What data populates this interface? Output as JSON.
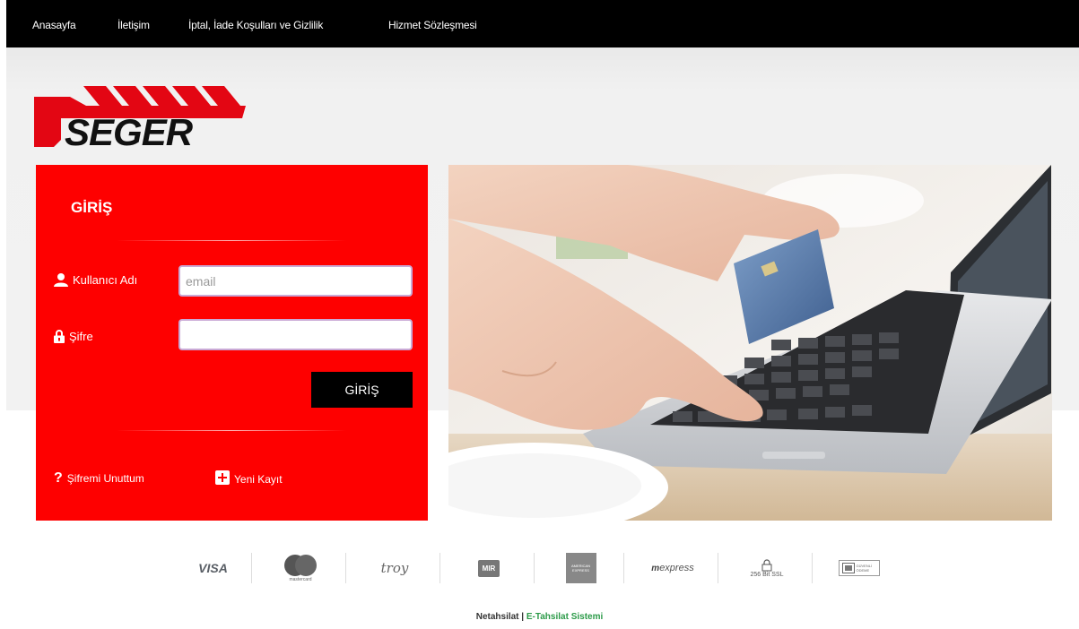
{
  "nav": {
    "items": [
      {
        "label": "Anasayfa"
      },
      {
        "label": "İletişim"
      },
      {
        "label": "İptal, İade Koşulları ve Gizlilik"
      },
      {
        "label": "Hizmet Sözleşmesi"
      }
    ]
  },
  "brand": {
    "logo_text": "SEGER",
    "color": "#fe0000"
  },
  "login": {
    "title": "GİRİŞ",
    "username_label": "Kullanıcı Adı",
    "username_placeholder": "email",
    "password_label": "Şifre",
    "password_placeholder": "",
    "submit_label": "GİRİŞ",
    "forgot_label": "Şifremi Unuttum",
    "register_label": "Yeni Kayıt"
  },
  "payments": {
    "visa": "VISA",
    "mastercard_caption": "mastercard",
    "troy": "troy",
    "mir": "MIR",
    "amex": "AMERICAN EXPRESS",
    "express": "express",
    "ssl": "256 Bit SSL",
    "secure_caption": "GÜVENLİ ÖDEME"
  },
  "footer": {
    "brand": "Netahsilat",
    "separator": " | ",
    "tagline": "E-Tahsilat Sistemi"
  }
}
